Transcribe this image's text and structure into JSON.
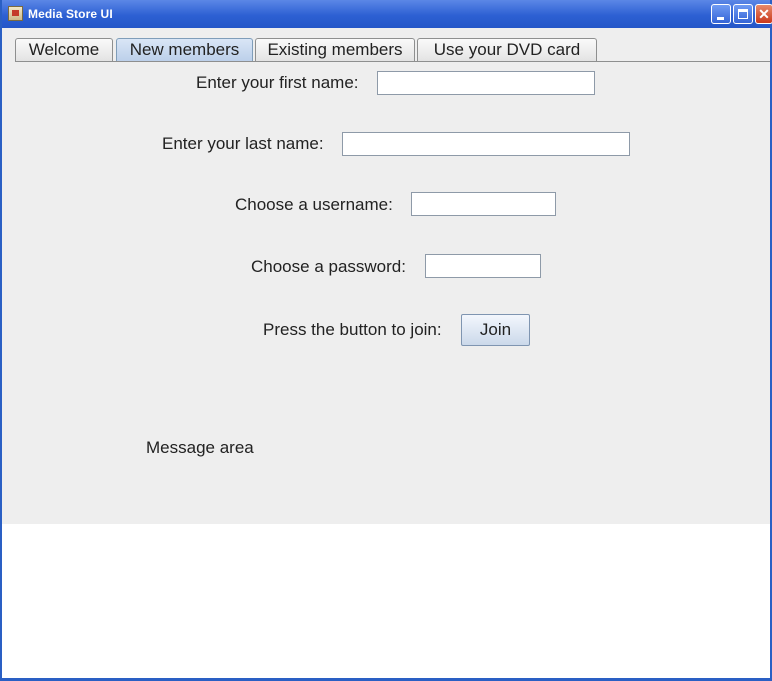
{
  "window": {
    "title": "Media Store UI"
  },
  "tabs": [
    {
      "label": "Welcome"
    },
    {
      "label": "New members"
    },
    {
      "label": "Existing members"
    },
    {
      "label": "Use your DVD card"
    }
  ],
  "selected_tab": "New members",
  "form": {
    "first_name_label": "Enter your first name:",
    "first_name_value": "",
    "last_name_label": "Enter your last name:",
    "last_name_value": "",
    "username_label": "Choose a username:",
    "username_value": "",
    "password_label": "Choose a password:",
    "password_value": "",
    "join_prompt": "Press the button to join:",
    "join_button": "Join"
  },
  "message_area": "Message area",
  "icons": {
    "app": "media-store-app-icon",
    "minimize": "minimize-icon",
    "maximize": "maximize-icon",
    "close": "close-icon"
  }
}
